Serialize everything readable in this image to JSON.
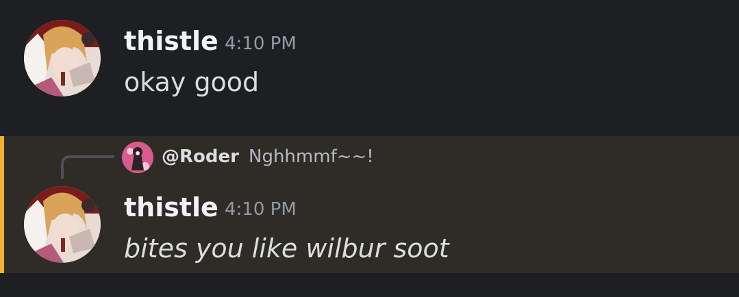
{
  "messages": [
    {
      "author": "thistle",
      "timestamp": "4:10 PM",
      "content": "okay good",
      "avatar_icon": "user-avatar-photo"
    },
    {
      "author": "thistle",
      "timestamp": "4:10 PM",
      "content": "bites you like wilbur soot",
      "avatar_icon": "user-avatar-photo",
      "mentioned": true,
      "reply": {
        "author": "@Roder",
        "text": "Nghhmmf~~!",
        "avatar_icon": "reply-avatar-photo"
      }
    }
  ],
  "colors": {
    "background": "#1e1f22",
    "mention_highlight": "#2f2c27",
    "mention_bar": "#f0b132",
    "username": "#f2f3f5",
    "timestamp": "#949ba4",
    "message_text": "#dbdee1"
  }
}
